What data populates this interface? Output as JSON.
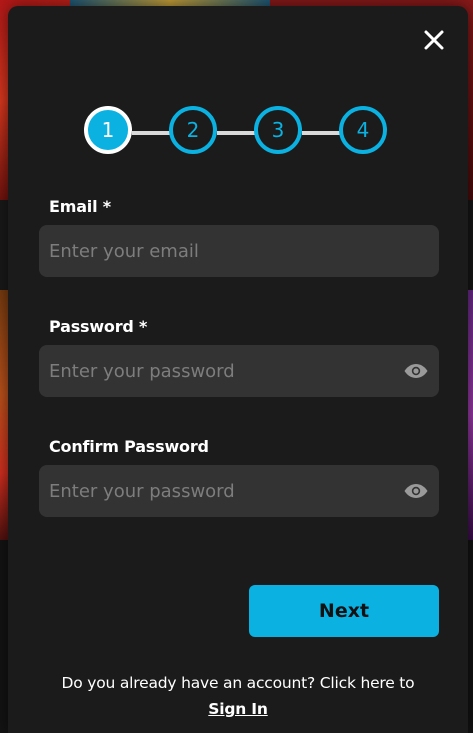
{
  "modal": {
    "close_icon": "close-icon",
    "steps": [
      "1",
      "2",
      "3",
      "4"
    ],
    "active_step": 1
  },
  "form": {
    "email": {
      "label": "Email *",
      "placeholder": "Enter your email",
      "value": ""
    },
    "password": {
      "label": "Password *",
      "placeholder": "Enter your password",
      "value": "",
      "toggle_icon": "eye-icon"
    },
    "confirm_password": {
      "label": "Confirm Password",
      "placeholder": "Enter your password",
      "value": "",
      "toggle_icon": "eye-icon"
    },
    "next_label": "Next"
  },
  "footer": {
    "prompt": "Do you already have an account? Click here to",
    "link_label": "Sign In"
  },
  "colors": {
    "accent": "#0ab1e1",
    "modal_bg": "#1b1b1b",
    "input_bg": "#333333",
    "text": "#ffffff",
    "placeholder": "#7d7d7d"
  }
}
